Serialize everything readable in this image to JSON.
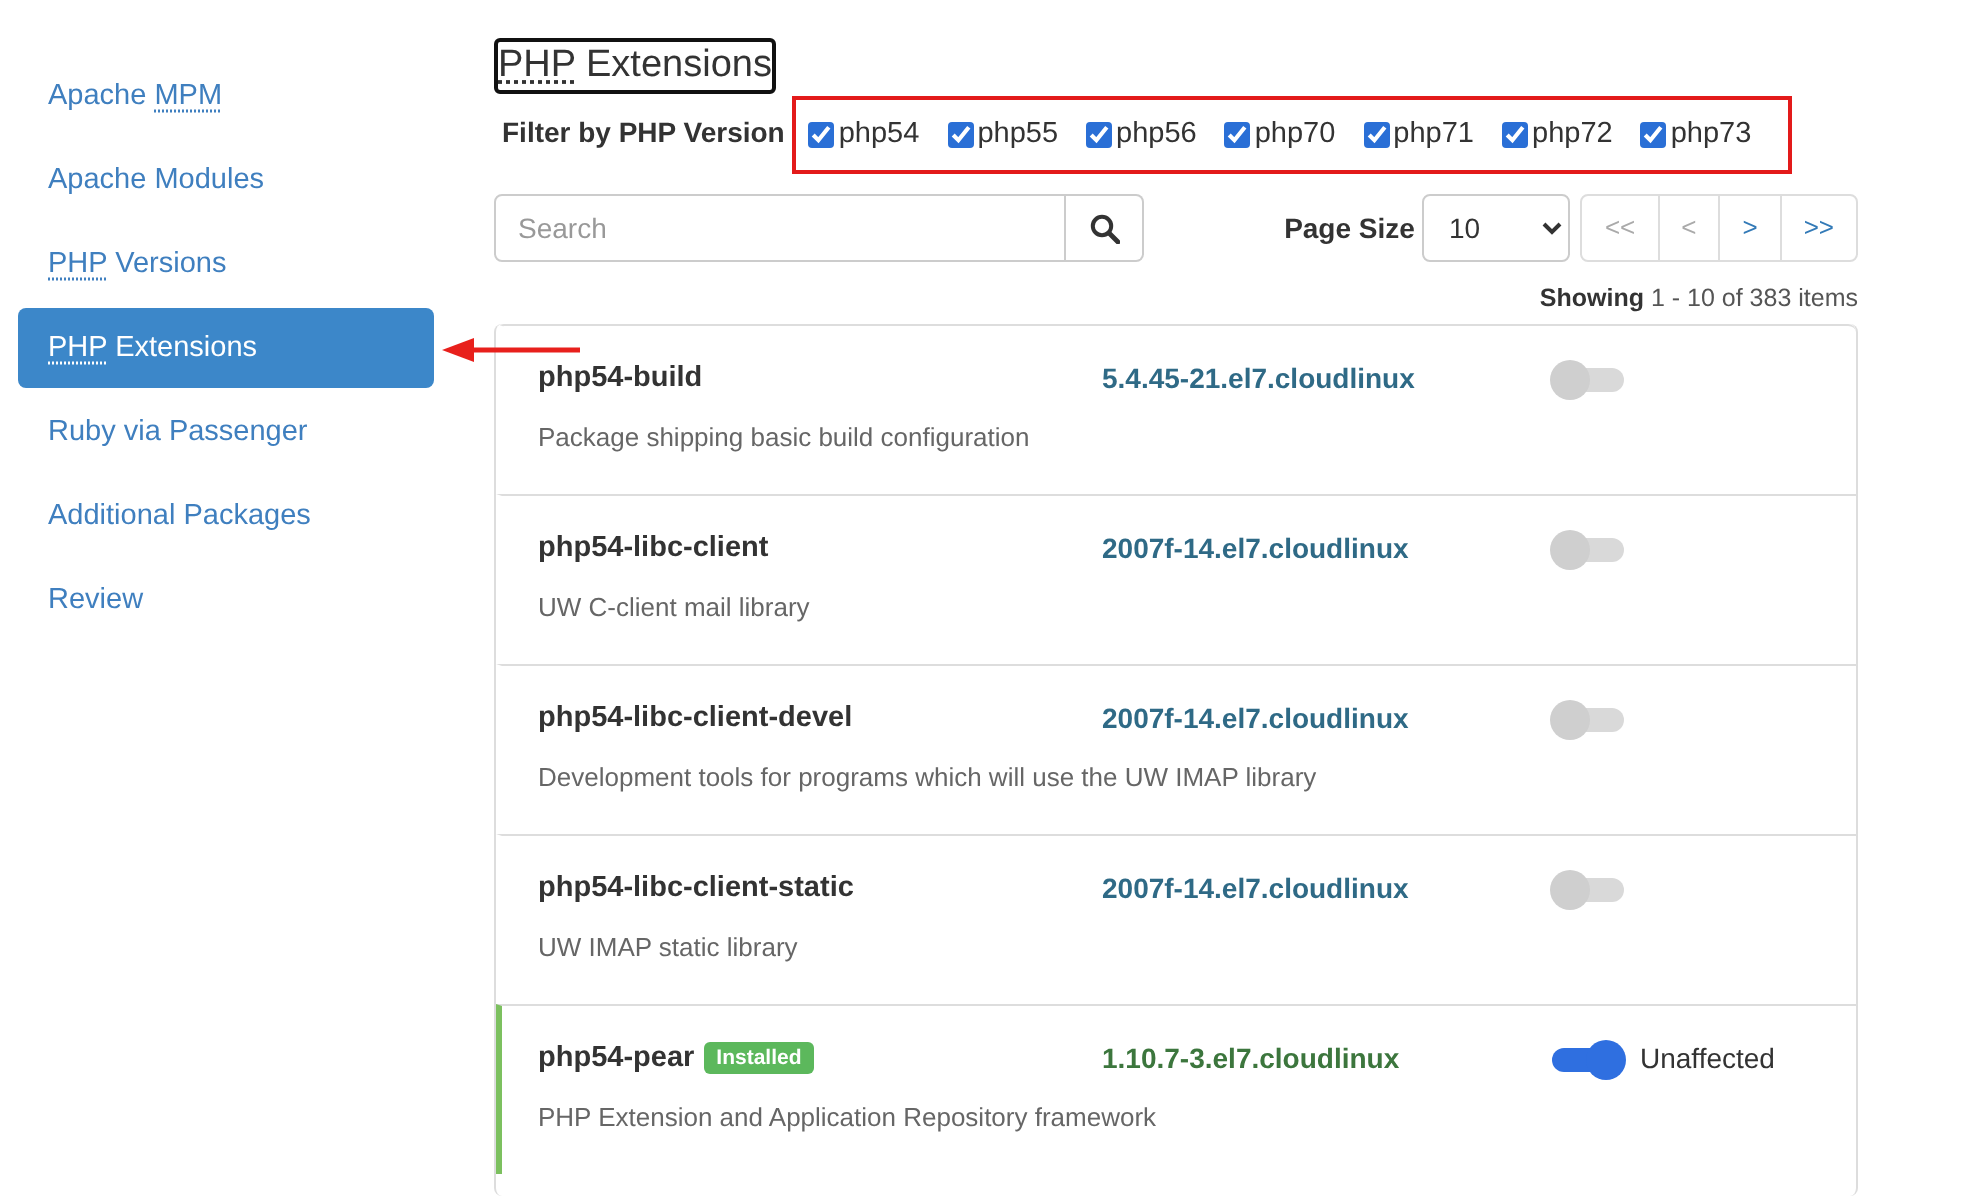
{
  "sidebar": {
    "items": [
      {
        "parts": [
          {
            "text": "Apache "
          },
          {
            "text": "MPM",
            "abbr": true
          }
        ],
        "selected": false
      },
      {
        "parts": [
          {
            "text": "Apache Modules"
          }
        ],
        "selected": false
      },
      {
        "parts": [
          {
            "text": "PHP",
            "abbr": true
          },
          {
            "text": " Versions"
          }
        ],
        "selected": false
      },
      {
        "parts": [
          {
            "text": "PHP",
            "abbr": true
          },
          {
            "text": " Extensions"
          }
        ],
        "selected": true
      },
      {
        "parts": [
          {
            "text": "Ruby via Passenger"
          }
        ],
        "selected": false
      },
      {
        "parts": [
          {
            "text": "Additional Packages"
          }
        ],
        "selected": false
      },
      {
        "parts": [
          {
            "text": "Review"
          }
        ],
        "selected": false
      }
    ]
  },
  "heading": {
    "parts": [
      {
        "text": "PHP",
        "abbr": true
      },
      {
        "text": " Extensions"
      }
    ]
  },
  "filter": {
    "label": "Filter by PHP Version",
    "versions": [
      {
        "label": "php54",
        "checked": true
      },
      {
        "label": "php55",
        "checked": true
      },
      {
        "label": "php56",
        "checked": true
      },
      {
        "label": "php70",
        "checked": true
      },
      {
        "label": "php71",
        "checked": true
      },
      {
        "label": "php72",
        "checked": true
      },
      {
        "label": "php73",
        "checked": true
      }
    ]
  },
  "search": {
    "placeholder": "Search"
  },
  "page_size": {
    "label": "Page Size",
    "value": "10"
  },
  "pager": [
    {
      "label": "<<",
      "disabled": true
    },
    {
      "label": "<",
      "disabled": true
    },
    {
      "label": ">",
      "disabled": false
    },
    {
      "label": ">>",
      "disabled": false
    }
  ],
  "showing": "**Showing** 1 - 10 of 383 items",
  "packages": [
    {
      "name": "php54-build",
      "version": "5.4.45-21.el7.cloudlinux",
      "description": "Package shipping basic build configuration",
      "installed": false,
      "on": false
    },
    {
      "name": "php54-libc-client",
      "version": "2007f-14.el7.cloudlinux",
      "description": "UW C-client mail library",
      "installed": false,
      "on": false
    },
    {
      "name": "php54-libc-client-devel",
      "version": "2007f-14.el7.cloudlinux",
      "description": "Development tools for programs which will use the UW IMAP library",
      "installed": false,
      "on": false
    },
    {
      "name": "php54-libc-client-static",
      "version": "2007f-14.el7.cloudlinux",
      "description": "UW IMAP static library",
      "installed": false,
      "on": false
    },
    {
      "name": "php54-pear",
      "badge": "Installed",
      "version": "1.10.7-3.el7.cloudlinux",
      "description": "PHP Extension and Application Repository framework",
      "installed": true,
      "on": true,
      "status": "Unaffected"
    }
  ]
}
